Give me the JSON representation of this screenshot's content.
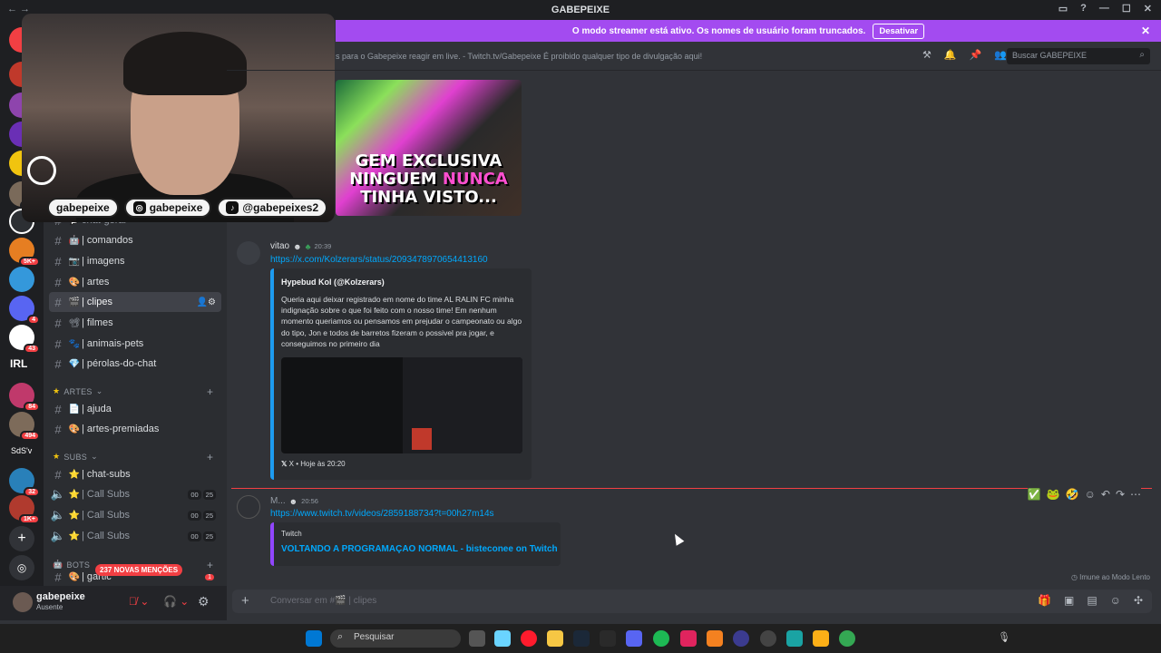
{
  "window": {
    "title": "GABEPEIXE"
  },
  "banner": {
    "text": "O modo streamer está ativo. Os nomes de usuário foram truncados.",
    "button": "Desativar"
  },
  "header": {
    "topic": "s para o Gabepeixe reagir em live. - Twitch.tv/Gabepeixe É proibido qualquer tipo de divulgação aqui!",
    "search_placeholder": "Buscar GABEPEIXE"
  },
  "rail": {
    "badges": [
      "NO",
      "5",
      "1",
      "2",
      "2",
      "299",
      "5K+",
      "4",
      "43",
      "84",
      "494",
      "32",
      "1K+"
    ],
    "labels": [
      "IRL",
      "SdS'v"
    ]
  },
  "overlay": {
    "socials": [
      "gabepeixe",
      "gabepeixe",
      "@gabepeixes2"
    ]
  },
  "channels": [
    {
      "label": "chat-geral",
      "emoji": "💬"
    },
    {
      "label": "| comandos",
      "emoji": "🤖"
    },
    {
      "label": "| imagens",
      "emoji": "📷"
    },
    {
      "label": "| artes",
      "emoji": "🎨"
    },
    {
      "label": "| clipes",
      "emoji": "🎬"
    },
    {
      "label": "| filmes",
      "emoji": "📽"
    },
    {
      "label": "| animais-pets",
      "emoji": "🐾"
    },
    {
      "label": "| pérolas-do-chat",
      "emoji": "💎"
    }
  ],
  "categories": {
    "artes": "ARTES",
    "subs": "SUBS",
    "bots": "BOTS"
  },
  "artes_channels": [
    {
      "label": "| ajuda",
      "emoji": "📄"
    },
    {
      "label": "| artes-premiadas",
      "emoji": "🎨"
    }
  ],
  "subs_channels": [
    {
      "label": "| chat-subs",
      "emoji": "⭐"
    },
    {
      "label": "| Call Subs",
      "emoji": "⭐",
      "count": "00",
      "max": "25"
    },
    {
      "label": "| Call Subs",
      "emoji": "⭐",
      "count": "00",
      "max": "25"
    },
    {
      "label": "| Call Subs",
      "emoji": "⭐",
      "count": "00",
      "max": "25"
    }
  ],
  "bots_channels": [
    {
      "label": "| gartic",
      "badge": "1"
    }
  ],
  "mentions_pill": "237 NOVAS MENÇÕES",
  "user": {
    "name": "gabepeixe",
    "status": "Ausente"
  },
  "thumbnail": {
    "line1_white": "GEM ",
    "line1_white2": "EXCLUSIVA",
    "line2_white": "NINGUEM ",
    "line2_pink": "NUNCA",
    "line3": "TINHA VISTO..."
  },
  "messages": [
    {
      "author": "vitao",
      "time": "20:39",
      "link": "https://x.com/Kolzerars/status/2093478970654413160",
      "embed": {
        "author": "Hypebud Kol (@Kolzerars)",
        "text": "Queria aqui deixar registrado em nome do time AL RALIN FC minha indignação sobre o que foi feito com o nosso time! Em nenhum momento queriamos ou pensamos em prejudar o campeonato ou algo do tipo, Jon e todos de barretos fizeram o possivel pra jogar, e conseguimos no primeiro dia",
        "footer": "X • Hoje às 20:20"
      }
    },
    {
      "author": "M...",
      "time": "20:56",
      "link": "https://www.twitch.tv/videos/2859188734?t=00h27m14s",
      "embed": {
        "provider": "Twitch",
        "title": "VOLTANDO A PROGRAMAÇAO NORMAL - bisteconee on Twitch"
      }
    }
  ],
  "slowmode": "Imune ao Modo Lento",
  "composer": {
    "placeholder": "Conversar em #🎬 | clipes"
  },
  "taskbar": {
    "search": "Pesquisar"
  },
  "colors": {
    "accent": "#a34bf0",
    "link": "#00a8fc",
    "danger": "#f23f43"
  }
}
